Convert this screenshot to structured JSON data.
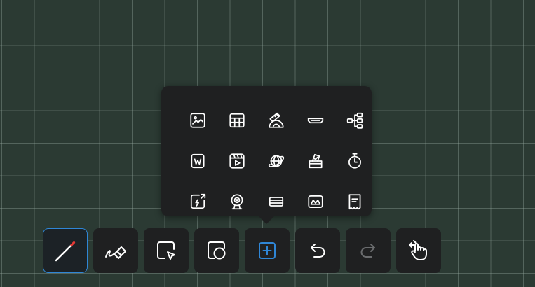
{
  "colors": {
    "board_background": "#2b3a33",
    "panel_background": "#1f2021",
    "icon_default": "#ffffff",
    "icon_disabled": "#6a6c6e",
    "accent": "#2f86d6",
    "pen_tip": "#e53935"
  },
  "insert_menu": {
    "items": [
      {
        "icon": "image-icon"
      },
      {
        "icon": "table-icon"
      },
      {
        "icon": "ruler-protractor-icon"
      },
      {
        "icon": "hdmi-icon"
      },
      {
        "icon": "mind-map-icon"
      },
      {
        "icon": "word-document-icon"
      },
      {
        "icon": "video-icon"
      },
      {
        "icon": "globe-icon"
      },
      {
        "icon": "ballot-box-icon"
      },
      {
        "icon": "stopwatch-icon"
      },
      {
        "icon": "flash-note-icon"
      },
      {
        "icon": "webcam-icon"
      },
      {
        "icon": "list-icon"
      },
      {
        "icon": "picture-frame-icon"
      },
      {
        "icon": "receipt-icon"
      }
    ]
  },
  "toolbar": {
    "tools": [
      {
        "icon": "pen-icon",
        "state": "active"
      },
      {
        "icon": "eraser-icon",
        "state": "normal"
      },
      {
        "icon": "select-icon",
        "state": "normal"
      },
      {
        "icon": "shapes-icon",
        "state": "normal"
      },
      {
        "icon": "insert-icon",
        "state": "open"
      },
      {
        "icon": "undo-icon",
        "state": "normal"
      },
      {
        "icon": "redo-icon",
        "state": "disabled"
      },
      {
        "icon": "gesture-icon",
        "state": "normal"
      }
    ]
  }
}
